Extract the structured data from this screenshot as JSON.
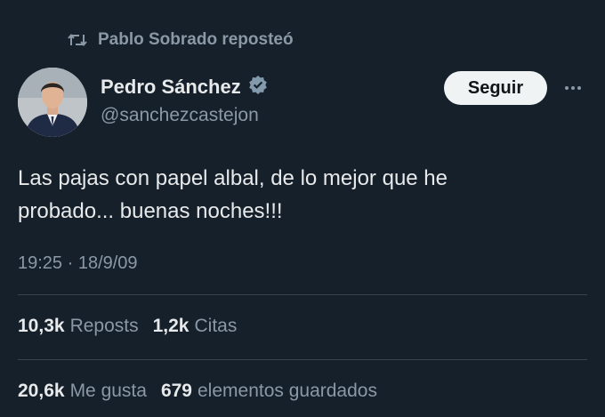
{
  "repost_banner": {
    "icon": "repost-icon",
    "text": "Pablo Sobrado reposteó"
  },
  "author": {
    "display_name": "Pedro Sánchez",
    "handle": "@sanchezcastejon",
    "verified_icon": "verified-badge-icon",
    "avatar": "profile-photo"
  },
  "actions": {
    "follow_label": "Seguir",
    "more_icon": "more-options-icon"
  },
  "tweet": {
    "lines": [
      "Las pajas con papel albal, de lo mejor que he",
      "probado... buenas noches!!!"
    ],
    "timestamp": "19:25 · 18/9/09"
  },
  "stats": {
    "reposts_count": "10,3k",
    "reposts_label": "Reposts",
    "quotes_count": "1,2k",
    "quotes_label": "Citas",
    "likes_count": "20,6k",
    "likes_label": "Me gusta",
    "bookmarks_count": "679",
    "bookmarks_label": "elementos guardados"
  },
  "colors": {
    "background": "#15202b",
    "primary_text": "#e7e9ea",
    "secondary_text": "#8b98a5",
    "divider": "#38444d",
    "verified": "#829aab",
    "follow_button_bg": "#eff3f4"
  }
}
